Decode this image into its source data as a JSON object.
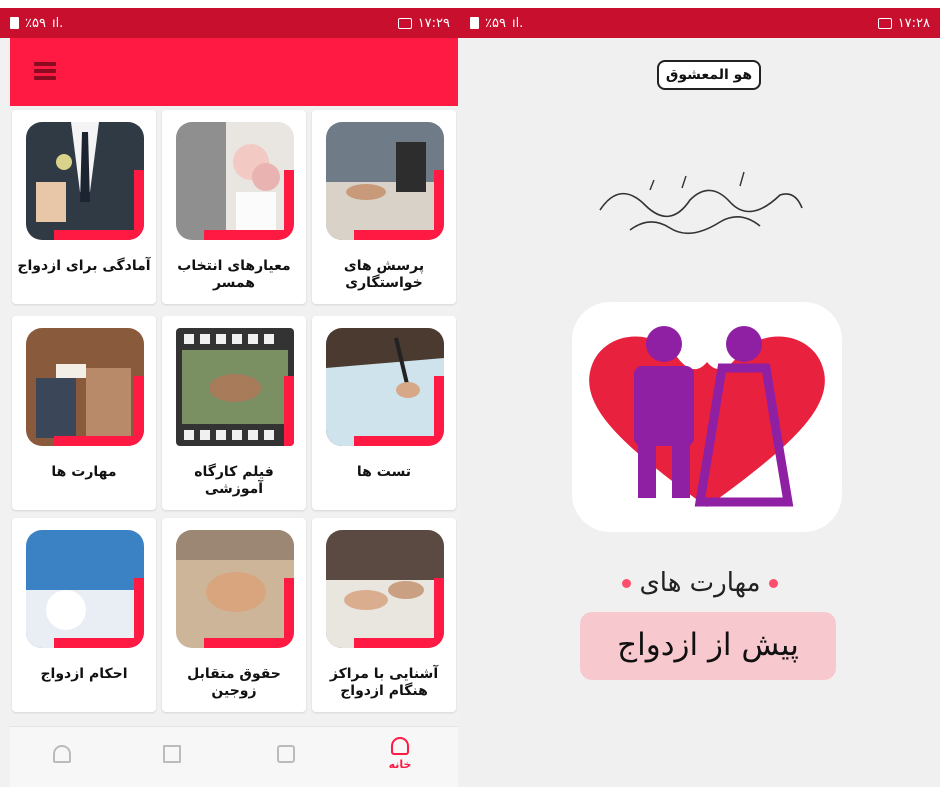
{
  "left_screen": {
    "status_bar": {
      "battery": "٪۵۹",
      "time": "۱۷:۲۹"
    },
    "grid": [
      {
        "title": "پرسش های خواستگاری",
        "image": "couple-writing"
      },
      {
        "title": "معیارهای انتخاب همسر",
        "image": "bride-bouquet"
      },
      {
        "title": "آمادگی برای ازدواج",
        "image": "groom-suit"
      },
      {
        "title": "تست ها",
        "image": "test-paper"
      },
      {
        "title": "فیلم کارگاه آموزشی",
        "image": "film-strip"
      },
      {
        "title": "مهارت ها",
        "image": "couple-reading"
      },
      {
        "title": "آشنایی با مراکز هنگام ازدواج",
        "image": "couple-desk"
      },
      {
        "title": "حقوق متقابل زوجین",
        "image": "holding-hands"
      },
      {
        "title": "احکام ازدواج",
        "image": "book-cover"
      }
    ],
    "bottom_nav": {
      "home_label": "خانه"
    }
  },
  "right_screen": {
    "status_bar": {
      "battery": "٪۵۹",
      "time": "۱۷:۲۸"
    },
    "bismillah": "هو المعشوق",
    "subtitle": "مهارت های",
    "title": "پیش از ازدواج"
  },
  "colors": {
    "accent": "#ff1a43",
    "status_bar": "#c8102e",
    "heart": "#e8213f",
    "couple": "#8f1fa3",
    "pill": "#f8c8cf"
  }
}
